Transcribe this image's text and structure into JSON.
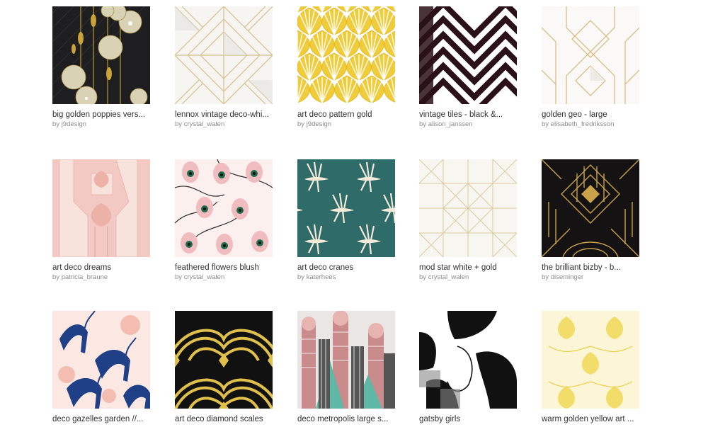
{
  "colors": {
    "title": "#333333",
    "artist": "#8a8a8a",
    "gold": "#d4b24a",
    "yellow": "#f0cc3a",
    "teal": "#2f6b68",
    "blush": "#f3c9c4",
    "black": "#1b1214",
    "navy": "#1f3f86"
  },
  "by_prefix": "by",
  "cards": [
    {
      "title": "big golden poppies vers...",
      "artist": "j9design",
      "icon": "poppies-thumbnail"
    },
    {
      "title": "lennox vintage deco-whi...",
      "artist": "crystal_walen",
      "icon": "geometric-thumbnail"
    },
    {
      "title": "art deco pattern gold",
      "artist": "j9design",
      "icon": "fan-scale-thumbnail"
    },
    {
      "title": "vintage tiles - black &...",
      "artist": "alison_janssen",
      "icon": "chevron-thumbnail"
    },
    {
      "title": "golden geo - large",
      "artist": "elisabeth_fredriksson",
      "icon": "diamond-geo-thumbnail"
    },
    {
      "title": "art deco dreams",
      "artist": "patricia_braune",
      "icon": "pink-deco-thumbnail"
    },
    {
      "title": "feathered flowers blush",
      "artist": "crystal_walen",
      "icon": "peacock-thumbnail"
    },
    {
      "title": "art deco cranes",
      "artist": "katerhees",
      "icon": "cranes-thumbnail"
    },
    {
      "title": "mod star white + gold",
      "artist": "crystal_walen",
      "icon": "star-geo-thumbnail"
    },
    {
      "title": "the brilliant bizby - b...",
      "artist": "diseminger",
      "icon": "black-gold-deco-thumbnail"
    },
    {
      "title": "deco gazelles garden //...",
      "artist": "",
      "icon": "gazelles-thumbnail"
    },
    {
      "title": "art deco diamond scales",
      "artist": "",
      "icon": "diamond-scales-thumbnail"
    },
    {
      "title": "deco metropolis large s...",
      "artist": "",
      "icon": "metropolis-thumbnail"
    },
    {
      "title": "gatsby girls",
      "artist": "",
      "icon": "gatsby-thumbnail"
    },
    {
      "title": "warm golden yellow art ...",
      "artist": "",
      "icon": "yellow-lotus-thumbnail"
    }
  ]
}
